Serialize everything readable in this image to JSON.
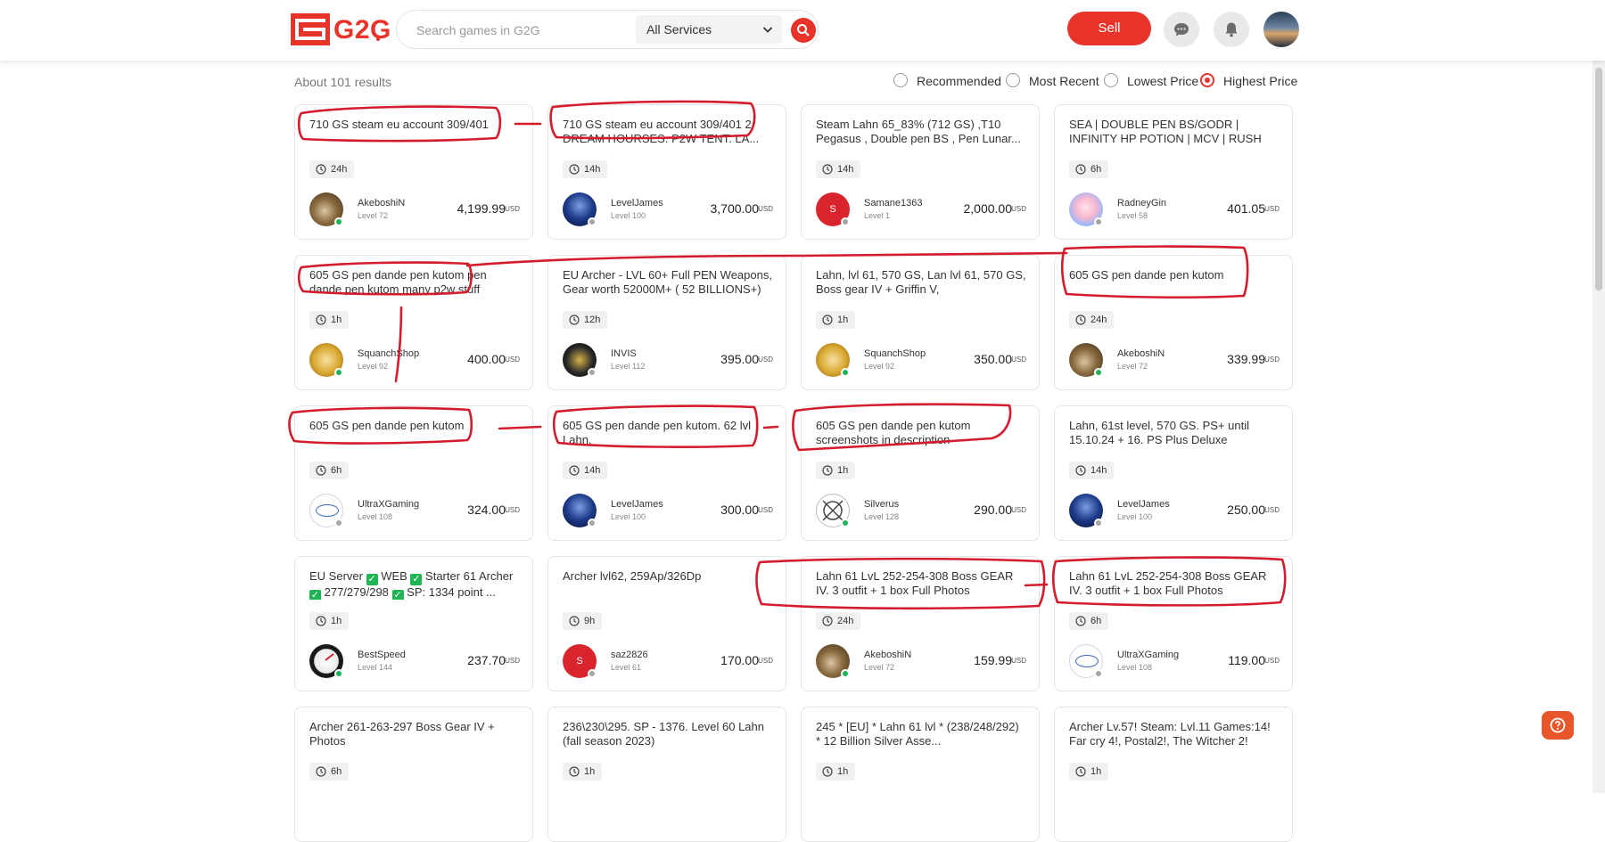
{
  "header": {
    "logo_text": "G2G",
    "search_placeholder": "Search games in G2G",
    "service_selected": "All Services",
    "sell_label": "Sell",
    "icons": [
      "chat-icon",
      "bell-icon",
      "search-icon",
      "chevron-down-icon"
    ]
  },
  "results": {
    "count": "About 101 results",
    "sort_options": [
      {
        "label": "Recommended",
        "selected": false
      },
      {
        "label": "Most Recent",
        "selected": false
      },
      {
        "label": "Lowest Price",
        "selected": false
      },
      {
        "label": "Highest Price",
        "selected": true
      }
    ]
  },
  "listings": [
    {
      "title": "710 GS steam eu account 309/401",
      "time": "24h",
      "seller": "AkeboshiN",
      "level": "Level 72",
      "price": "4,199.99",
      "currency": "USD",
      "online": true
    },
    {
      "title": "710 GS steam eu account 309/401 2 DREAM HOURSES. P2W TENT. LA...",
      "time": "14h",
      "seller": "LevelJames",
      "level": "Level 100",
      "price": "3,700.00",
      "currency": "USD",
      "online": false
    },
    {
      "title": "Steam Lahn 65_83% (712 GS) ,T10 Pegasus , Double pen BS , Pen Lunar...",
      "time": "14h",
      "seller": "Samane1363",
      "level": "Level 1",
      "price": "2,000.00",
      "currency": "USD",
      "online": false
    },
    {
      "title": "SEA | DOUBLE PEN BS/GODR | INFINITY HP POTION | MCV | RUSH",
      "time": "6h",
      "seller": "RadneyGin",
      "level": "Level 58",
      "price": "401.05",
      "currency": "USD",
      "online": false
    },
    {
      "title": "605 GS pen dande pen kutom pen dande pen kutom many p2w stuff",
      "time": "1h",
      "seller": "SquanchShop",
      "level": "Level 92",
      "price": "400.00",
      "currency": "USD",
      "online": true
    },
    {
      "title": "EU Archer - LVL 60+ Full PEN Weapons, Gear worth 52000M+ ( 52 BILLIONS+)",
      "time": "12h",
      "seller": "INVIS",
      "level": "Level 112",
      "price": "395.00",
      "currency": "USD",
      "online": false
    },
    {
      "title": "Lahn, lvl 61, 570 GS, Lan lvl 61, 570 GS, Boss gear IV + Griffin V,",
      "time": "1h",
      "seller": "SquanchShop",
      "level": "Level 92",
      "price": "350.00",
      "currency": "USD",
      "online": true
    },
    {
      "title": "605 GS pen dande pen kutom",
      "time": "24h",
      "seller": "AkeboshiN",
      "level": "Level 72",
      "price": "339.99",
      "currency": "USD",
      "online": true
    },
    {
      "title": "605 GS pen dande pen kutom",
      "time": "6h",
      "seller": "UltraXGaming",
      "level": "Level 108",
      "price": "324.00",
      "currency": "USD",
      "online": false
    },
    {
      "title": "605 GS pen dande pen kutom. 62 lvl Lahn.",
      "time": "14h",
      "seller": "LevelJames",
      "level": "Level 100",
      "price": "300.00",
      "currency": "USD",
      "online": false
    },
    {
      "title": "605 GS pen dande pen kutom screenshots in description",
      "time": "1h",
      "seller": "Silverus",
      "level": "Level 128",
      "price": "290.00",
      "currency": "USD",
      "online": true
    },
    {
      "title": "Lahn, 61st level, 570 GS. PS+ until 15.10.24 + 16. PS Plus Deluxe",
      "time": "14h",
      "seller": "LevelJames",
      "level": "Level 100",
      "price": "250.00",
      "currency": "USD",
      "online": false
    },
    {
      "title": "EU Server ✅ WEB ✅ Starter 61 Archer ✅ 277/279/298 ✅ SP: 1334 point ...",
      "time": "1h",
      "seller": "BestSpeed",
      "level": "Level 144",
      "price": "237.70",
      "currency": "USD",
      "online": true
    },
    {
      "title": "Archer lvl62, 259Ap/326Dp",
      "time": "9h",
      "seller": "saz2826",
      "level": "Level 61",
      "price": "170.00",
      "currency": "USD",
      "online": false
    },
    {
      "title": "Lahn 61 LvL 252-254-308 Boss GEAR IV. 3 outfit + 1 box Full Photos",
      "time": "24h",
      "seller": "AkeboshiN",
      "level": "Level 72",
      "price": "159.99",
      "currency": "USD",
      "online": true
    },
    {
      "title": "Lahn 61 LvL 252-254-308 Boss GEAR IV. 3 outfit + 1 box Full Photos",
      "time": "6h",
      "seller": "UltraXGaming",
      "level": "Level 108",
      "price": "119.00",
      "currency": "USD",
      "online": false
    },
    {
      "title": "Archer 261-263-297 Boss Gear IV + Photos",
      "time": "6h"
    },
    {
      "title": "236\\230\\295. SP - 1376. Level 60 Lahn (fall season 2023)",
      "time": "1h"
    },
    {
      "title": "245 * [EU] * Lahn 61 lvl * (238/248/292) * 12 Billion Silver Asse...",
      "time": "1h"
    },
    {
      "title": "Archer Lv.57! Steam: Lvl.11 Games:14! Far cry 4!, Postal2!, The Witcher 2!",
      "time": "1h"
    }
  ],
  "colors": {
    "brand": "#e8332a",
    "online": "#20b455",
    "offline": "#a6a6a6",
    "annotation": "#d41c2c"
  }
}
